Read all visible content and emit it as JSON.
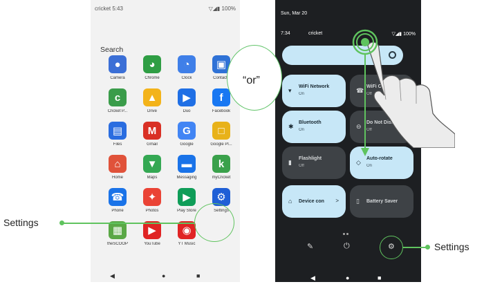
{
  "left_phone": {
    "status": {
      "carrier_time": "cricket 5:43",
      "right": "▽◢▮ 100%"
    },
    "search_label": "Search",
    "apps": [
      {
        "label": "Camera",
        "icon": "camera-icon",
        "glyph": "●",
        "color": "#3b6fd6"
      },
      {
        "label": "Chrome",
        "icon": "chrome-icon",
        "glyph": "◕",
        "color": "#2f9e44"
      },
      {
        "label": "Clock",
        "icon": "clock-icon",
        "glyph": "◔",
        "color": "#3f7fe8"
      },
      {
        "label": "Contacts",
        "icon": "contacts-icon",
        "glyph": "▣",
        "color": "#2f72d6"
      },
      {
        "label": "Cricket P...",
        "icon": "cricket-p-icon",
        "glyph": "c",
        "color": "#3a9c4a"
      },
      {
        "label": "Drive",
        "icon": "drive-icon",
        "glyph": "▲",
        "color": "#f3b31a"
      },
      {
        "label": "Duo",
        "icon": "duo-icon",
        "glyph": "▶",
        "color": "#1f6fe5"
      },
      {
        "label": "Facebook",
        "icon": "facebook-icon",
        "glyph": "f",
        "color": "#1877f2"
      },
      {
        "label": "Files",
        "icon": "files-icon",
        "glyph": "▤",
        "color": "#2a6de0"
      },
      {
        "label": "Gmail",
        "icon": "gmail-icon",
        "glyph": "M",
        "color": "#d93025"
      },
      {
        "label": "Google",
        "icon": "google-icon",
        "glyph": "G",
        "color": "#4285f4"
      },
      {
        "label": "Google Pl...",
        "icon": "google-play-icon",
        "glyph": "□",
        "color": "#e8b21a"
      },
      {
        "label": "Home",
        "icon": "home-icon",
        "glyph": "⌂",
        "color": "#e0523a"
      },
      {
        "label": "Maps",
        "icon": "maps-icon",
        "glyph": "▼",
        "color": "#34a853"
      },
      {
        "label": "Messaging",
        "icon": "messaging-icon",
        "glyph": "▬",
        "color": "#1a73e8"
      },
      {
        "label": "myCricket",
        "icon": "mycricket-icon",
        "glyph": "k",
        "color": "#3aa14b"
      },
      {
        "label": "Phone",
        "icon": "phone-icon",
        "glyph": "☎",
        "color": "#1a73e8"
      },
      {
        "label": "Photos",
        "icon": "photos-icon",
        "glyph": "✦",
        "color": "#ea4335"
      },
      {
        "label": "Play Store",
        "icon": "play-store-icon",
        "glyph": "▶",
        "color": "#0f9d58"
      },
      {
        "label": "Settings",
        "icon": "settings-icon",
        "glyph": "⚙",
        "color": "#1f5fd6"
      },
      {
        "label": "theSCOOP",
        "icon": "thescoop-icon",
        "glyph": "▦",
        "color": "#5aa846"
      },
      {
        "label": "YouTube",
        "icon": "youtube-icon",
        "glyph": "▶",
        "color": "#e02424"
      },
      {
        "label": "YT Music",
        "icon": "yt-music-icon",
        "glyph": "◉",
        "color": "#e02424"
      }
    ],
    "nav": {
      "back": "◀",
      "home": "●",
      "recents": "■"
    }
  },
  "right_phone": {
    "date": "Sun, Mar 20",
    "time": "7:34",
    "carrier": "cricket",
    "status_right": "▽◢▮ 100%",
    "tiles": [
      {
        "title": "WiFi Network",
        "sub": "On",
        "state": "on",
        "icon": "▾",
        "icon_name": "wifi-icon"
      },
      {
        "title": "WiFi Calling",
        "sub": "Off",
        "state": "off",
        "icon": "☎",
        "icon_name": "wifi-calling-icon"
      },
      {
        "title": "Bluetooth",
        "sub": "On",
        "state": "on",
        "icon": "✱",
        "icon_name": "bluetooth-icon"
      },
      {
        "title": "Do Not Distur",
        "sub": "Off",
        "state": "off",
        "icon": "⊖",
        "icon_name": "do-not-disturb-icon"
      },
      {
        "title": "Flashlight",
        "sub": "Off",
        "state": "off",
        "icon": "▮",
        "icon_name": "flashlight-icon"
      },
      {
        "title": "Auto-rotate",
        "sub": "On",
        "state": "on",
        "icon": "◇",
        "icon_name": "auto-rotate-icon"
      },
      {
        "title": "Device con",
        "sub": "",
        "state": "on",
        "icon": "⌂",
        "icon_name": "device-controls-icon",
        "chevron": ">"
      },
      {
        "title": "Battery Saver",
        "sub": "",
        "state": "off",
        "icon": "▯",
        "icon_name": "battery-saver-icon"
      }
    ],
    "actions": {
      "edit": "✎",
      "power": "⏻",
      "settings": "⚙"
    },
    "nav": {
      "back": "◀",
      "home": "●",
      "recents": "■"
    }
  },
  "annotations": {
    "or_text": "“or”",
    "settings_left": "Settings",
    "settings_right": "Settings",
    "accent": "#5fc35e"
  }
}
